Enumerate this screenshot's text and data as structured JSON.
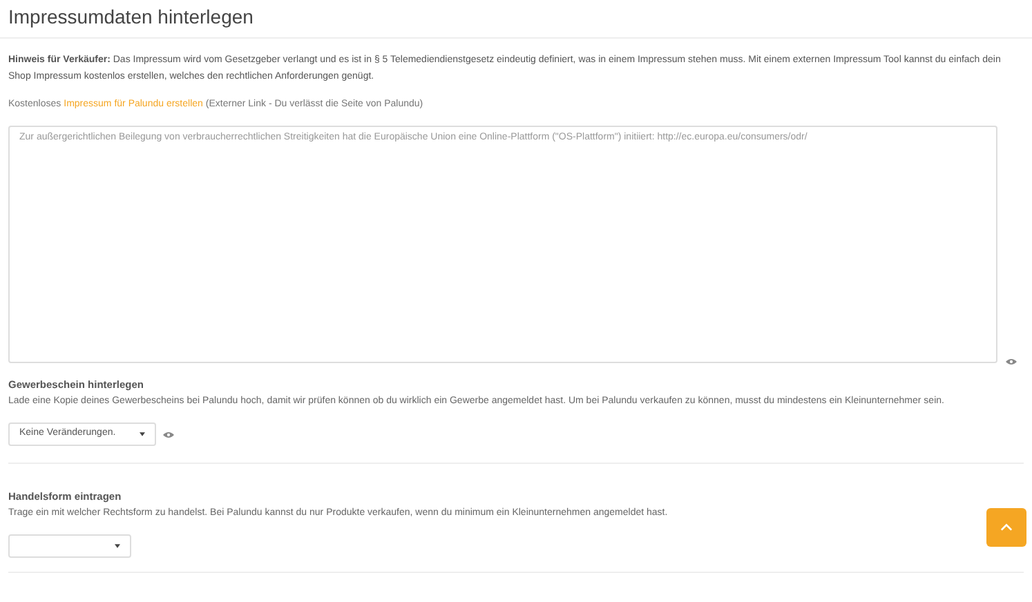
{
  "title": "Impressumdaten hinterlegen",
  "hint": "**Hinweis für Verkäufer:** Das Impressum wird vom Gesetzgeber verlangt und es ist in § 5 Telemediendienstgesetz eindeutig definiert, was in einem Impressum stehen muss. Mit einem externen Impressum Tool kannst du einfach dein Shop Impressum kostenlos erstellen, welches den rechtlichen Anforderungen genügt.",
  "link_line": {
    "before": "Kostenloses",
    "link": "Impressum für Palundu erstellen",
    "after": "(Externer Link - Du verlässt die Seite von Palundu)"
  },
  "imprint_field": {
    "placeholder": "Zur außergerichtlichen Beilegung von verbraucherrechtlichen Streitigkeiten hat die Europäische Union eine Online-Plattform (\"OS-Plattform\") initiiert: http://ec.europa.eu/consumers/odr/"
  },
  "sections": [
    {
      "heading": "Gewerbeschein hinterlegen",
      "description": "Lade eine Kopie deines Gewerbescheins bei Palundu hoch, damit wir prüfen können ob du wirklich ein Gewerbe angemeldet hast. Um bei Palundu verkaufen zu können, musst du mindestens ein Kleinunternehmer sein.",
      "dropdown_value": "Keine Veränderungen.",
      "has_eye": true
    },
    {
      "heading": "Handelsform eintragen",
      "description": "Trage ein mit welcher Rechtsform zu handelst. Bei Palundu kannst du nur Produkte verkaufen, wenn du minimum ein Kleinunternehmen angemeldet hast.",
      "has_eye": false
    }
  ]
}
